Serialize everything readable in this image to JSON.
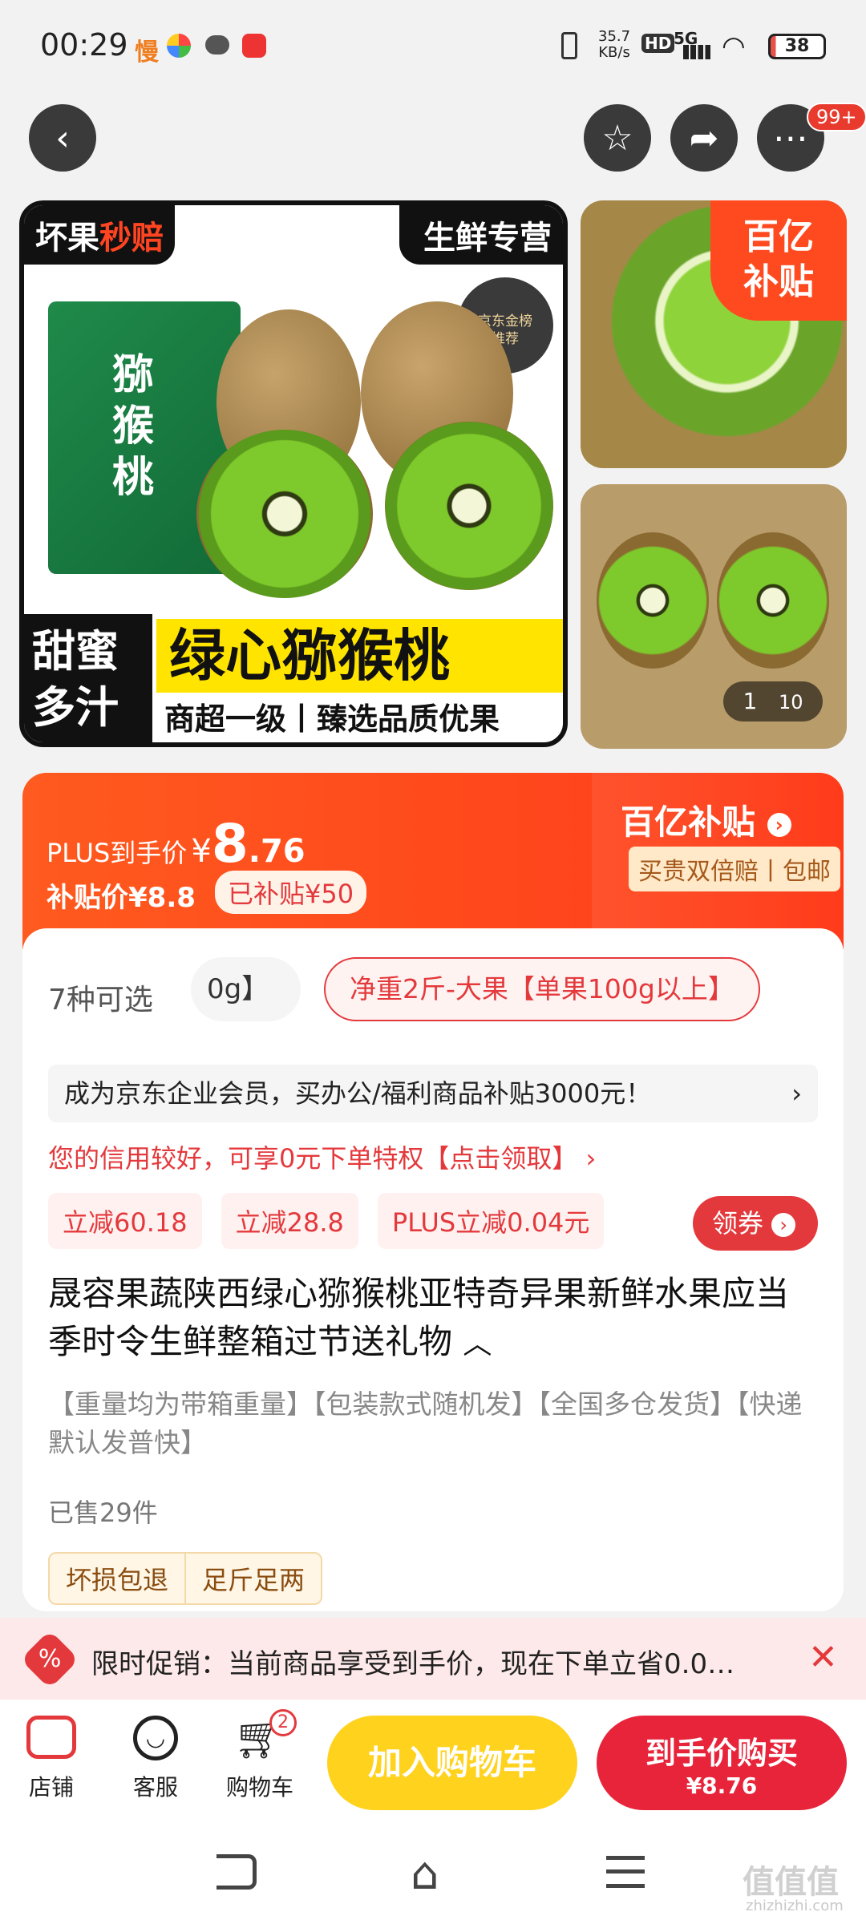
{
  "status_bar": {
    "time": "00:29",
    "app1": "慢",
    "net_speed_top": "35.7",
    "net_speed_bottom": "KB/s",
    "hd": "HD",
    "signal": "5G",
    "battery": "38"
  },
  "nav": {
    "badge": "99+"
  },
  "gallery": {
    "top_left_tag_a": "坏果",
    "top_left_tag_b": "秒赔",
    "top_right_tag": "生鲜专营",
    "rank_seal_line1": "京东金榜",
    "rank_seal_line2": "推荐",
    "box_text": "猕猴桃",
    "banner_left_1": "甜蜜",
    "banner_left_2": "多汁",
    "banner_title": "绿心猕猴桃",
    "banner_sub": "商超一级丨臻选品质优果",
    "billion_line1": "百亿",
    "billion_line2": "补贴",
    "counter_current": "1",
    "counter_total": "10"
  },
  "price": {
    "plus_label": "PLUS到手价",
    "plus_currency": "¥",
    "plus_int": "8",
    "plus_dec": ".76",
    "subsidy_label": "补贴价¥8.8",
    "subsidy_badge": "已补贴¥50",
    "brand_label": "百亿补贴",
    "brand_sub": "买贵双倍赔丨包邮"
  },
  "options": {
    "count_label": "7种可选",
    "prev_option": "0g】",
    "selected_option": "净重2斤-大果【单果100g以上】"
  },
  "enterprise_banner": "成为京东企业会员，买办公/福利商品补贴3000元！",
  "credit_text": "您的信用较好，可享0元下单特权【点击领取】",
  "discounts": [
    "立减60.18",
    "立减28.8",
    "PLUS立减0.04元"
  ],
  "coupon_button": "领券",
  "product_title": "晟容果蔬陕西绿心猕猴桃亚特奇异果新鲜水果应当季时令生鲜整箱过节送礼物",
  "notes": "【重量均为带箱重量】【包装款式随机发】【全国多仓发货】【快递默认发普快】",
  "sold": "已售29件",
  "service_tags": [
    "坏损包退",
    "足斤足两"
  ],
  "promo_bar": "限时促销：当前商品享受到手价，现在下单立省0.0…",
  "bottom_nav": {
    "shop": "店铺",
    "service": "客服",
    "cart": "购物车",
    "cart_count": "2",
    "add_cart": "加入购物车",
    "buy_line1": "到手价购买",
    "buy_line2": "¥8.76"
  },
  "watermark": {
    "logo": "值值值",
    "url": "zhizhizhi.com"
  },
  "colors": {
    "accent": "#e4393c",
    "orange": "#ff4a1f",
    "yellow": "#ffd21e"
  }
}
